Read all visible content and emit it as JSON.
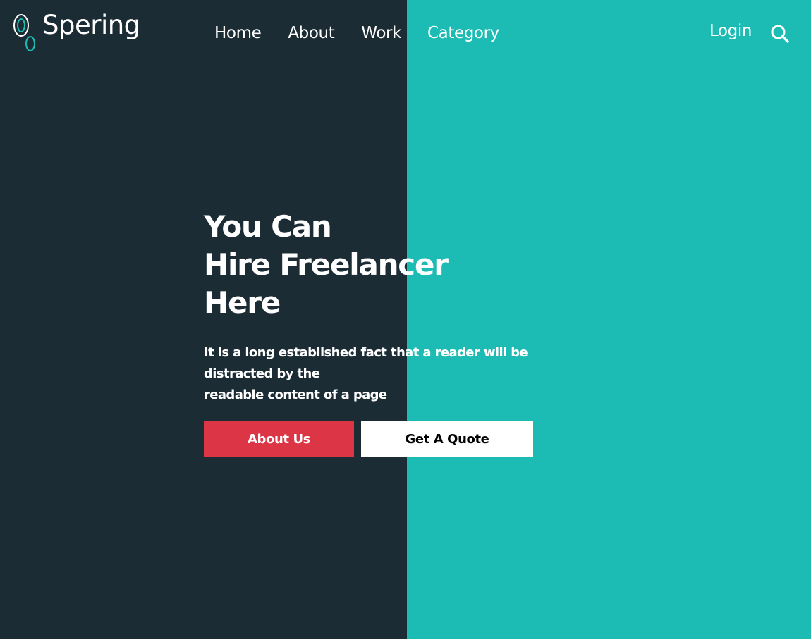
{
  "brand": {
    "name": "Spering",
    "accent_color": "#1cbcb4",
    "dark_color": "#1c2c35"
  },
  "nav": {
    "items": [
      {
        "label": "Home"
      },
      {
        "label": "About"
      },
      {
        "label": "Work"
      },
      {
        "label": "Category"
      }
    ],
    "login_label": "Login",
    "search_icon": "search-icon"
  },
  "hero": {
    "title_lines": [
      "You Can",
      "Hire Freelancer",
      "Here"
    ],
    "text_lines": [
      "It is a long established fact that a reader will be",
      "distracted by the",
      "readable content of a page"
    ],
    "primary_button": "About Us",
    "primary_button_color": "#dc3545",
    "secondary_button": "Get A Quote"
  }
}
